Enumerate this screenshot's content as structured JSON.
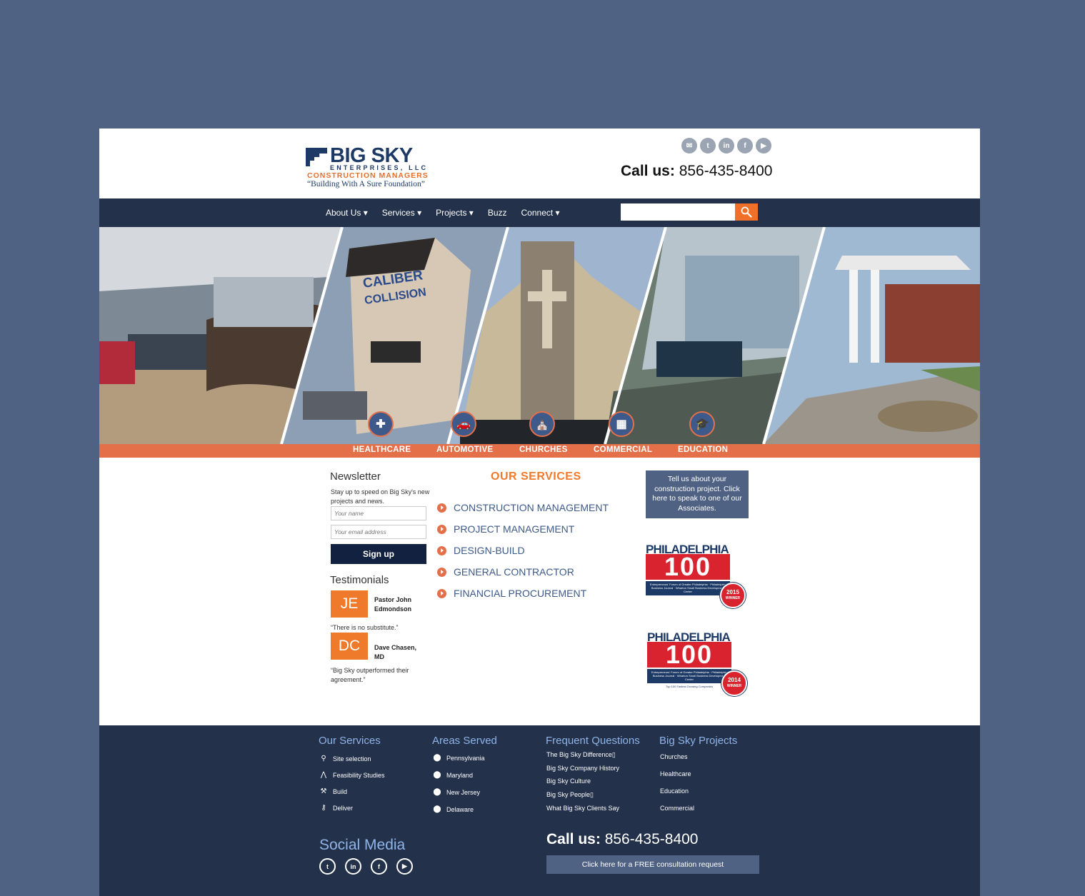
{
  "header": {
    "logo": {
      "title": "BIG SKY",
      "subtitle": "ENTERPRISES, LLC",
      "tagline_1": "CONSTRUCTION MANAGERS",
      "tagline_2": "“Building With A Sure Foundation”"
    },
    "social_icons": [
      "email-icon",
      "twitter-icon",
      "linkedin-icon",
      "facebook-icon",
      "youtube-icon"
    ],
    "call_label": "Call us:",
    "phone": "856-435-8400"
  },
  "nav": {
    "items": [
      {
        "label": "About Us ▾"
      },
      {
        "label": "Services ▾"
      },
      {
        "label": "Projects ▾"
      },
      {
        "label": "Buzz"
      },
      {
        "label": "Connect ▾"
      }
    ],
    "search_placeholder": ""
  },
  "hero": {
    "categories": [
      "HEALTHCARE",
      "AUTOMOTIVE",
      "CHURCHES",
      "COMMERCIAL",
      "EDUCATION"
    ],
    "sign_text_1": "CALIBER",
    "sign_text_2": "COLLISION"
  },
  "newsletter": {
    "title": "Newsletter",
    "description": "Stay up to speed on Big Sky's new projects and news.",
    "name_placeholder": "Your name",
    "email_placeholder": "Your email address",
    "button": "Sign up"
  },
  "testimonials": {
    "title": "Testimonials",
    "items": [
      {
        "initials": "JE",
        "name": "Pastor John Edmondson",
        "quote": "“There is no substitute.”"
      },
      {
        "initials": "DC",
        "name": "Dave Chasen, MD",
        "quote": "“Big Sky outperformed their agreement.”"
      }
    ]
  },
  "services": {
    "title": "OUR SERVICES",
    "items": [
      "CONSTRUCTION MANAGEMENT",
      "PROJECT MANAGEMENT",
      "DESIGN-BUILD",
      "GENERAL CONTRACTOR",
      "FINANCIAL PROCUREMENT"
    ]
  },
  "sidebar": {
    "cta": "Tell us about your construction project. Click here to speak to one of our Associates.",
    "awards": [
      {
        "city": "PHILADELPHIA",
        "number": "100",
        "strip": "Entrepreneurs' Forum of Greater Philadelphia · Philadelphia Business Journal · Wharton Small Business Development Center",
        "year": "2015",
        "badge": "WINNER",
        "foot": ""
      },
      {
        "city": "PHILADELPHIA",
        "number": "100",
        "strip": "Entrepreneurs' Forum of Greater Philadelphia · Philadelphia Business Journal · Wharton Small Business Development Center",
        "year": "2014",
        "badge": "WINNER",
        "foot": "Top 100 Fastest Growing Companies"
      }
    ]
  },
  "footer": {
    "our_services": {
      "title": "Our Services",
      "items": [
        {
          "icon": "search-icon",
          "label": "Site selection"
        },
        {
          "icon": "compass-icon",
          "label": "Feasibility Studies"
        },
        {
          "icon": "hammer-icon",
          "label": "Build"
        },
        {
          "icon": "key-icon",
          "label": "Deliver"
        }
      ]
    },
    "areas": {
      "title": "Areas Served",
      "items": [
        "Pennsylvania",
        "Maryland",
        "New Jersey",
        "Delaware"
      ]
    },
    "faq": {
      "title": "Frequent Questions",
      "items": [
        "The Big Sky Difference▯",
        "Big Sky Company History",
        "Big Sky Culture",
        "Big Sky People▯",
        "What Big Sky Clients Say"
      ]
    },
    "projects": {
      "title": "Big Sky Projects",
      "items": [
        "Churches",
        "Healthcare",
        "Education",
        "Commercial"
      ]
    },
    "social_title": "Social Media",
    "social_icons": [
      "twitter-icon",
      "linkedin-icon",
      "facebook-icon",
      "youtube-icon"
    ],
    "call_label": "Call us:",
    "phone": "856-435-8400",
    "cta": "Click here for a FREE consultation request"
  },
  "colors": {
    "background": "#4f6283",
    "nav": "#23314a",
    "accent": "#f07a2c",
    "catbar": "#e4704a",
    "link": "#3d5a8a"
  }
}
